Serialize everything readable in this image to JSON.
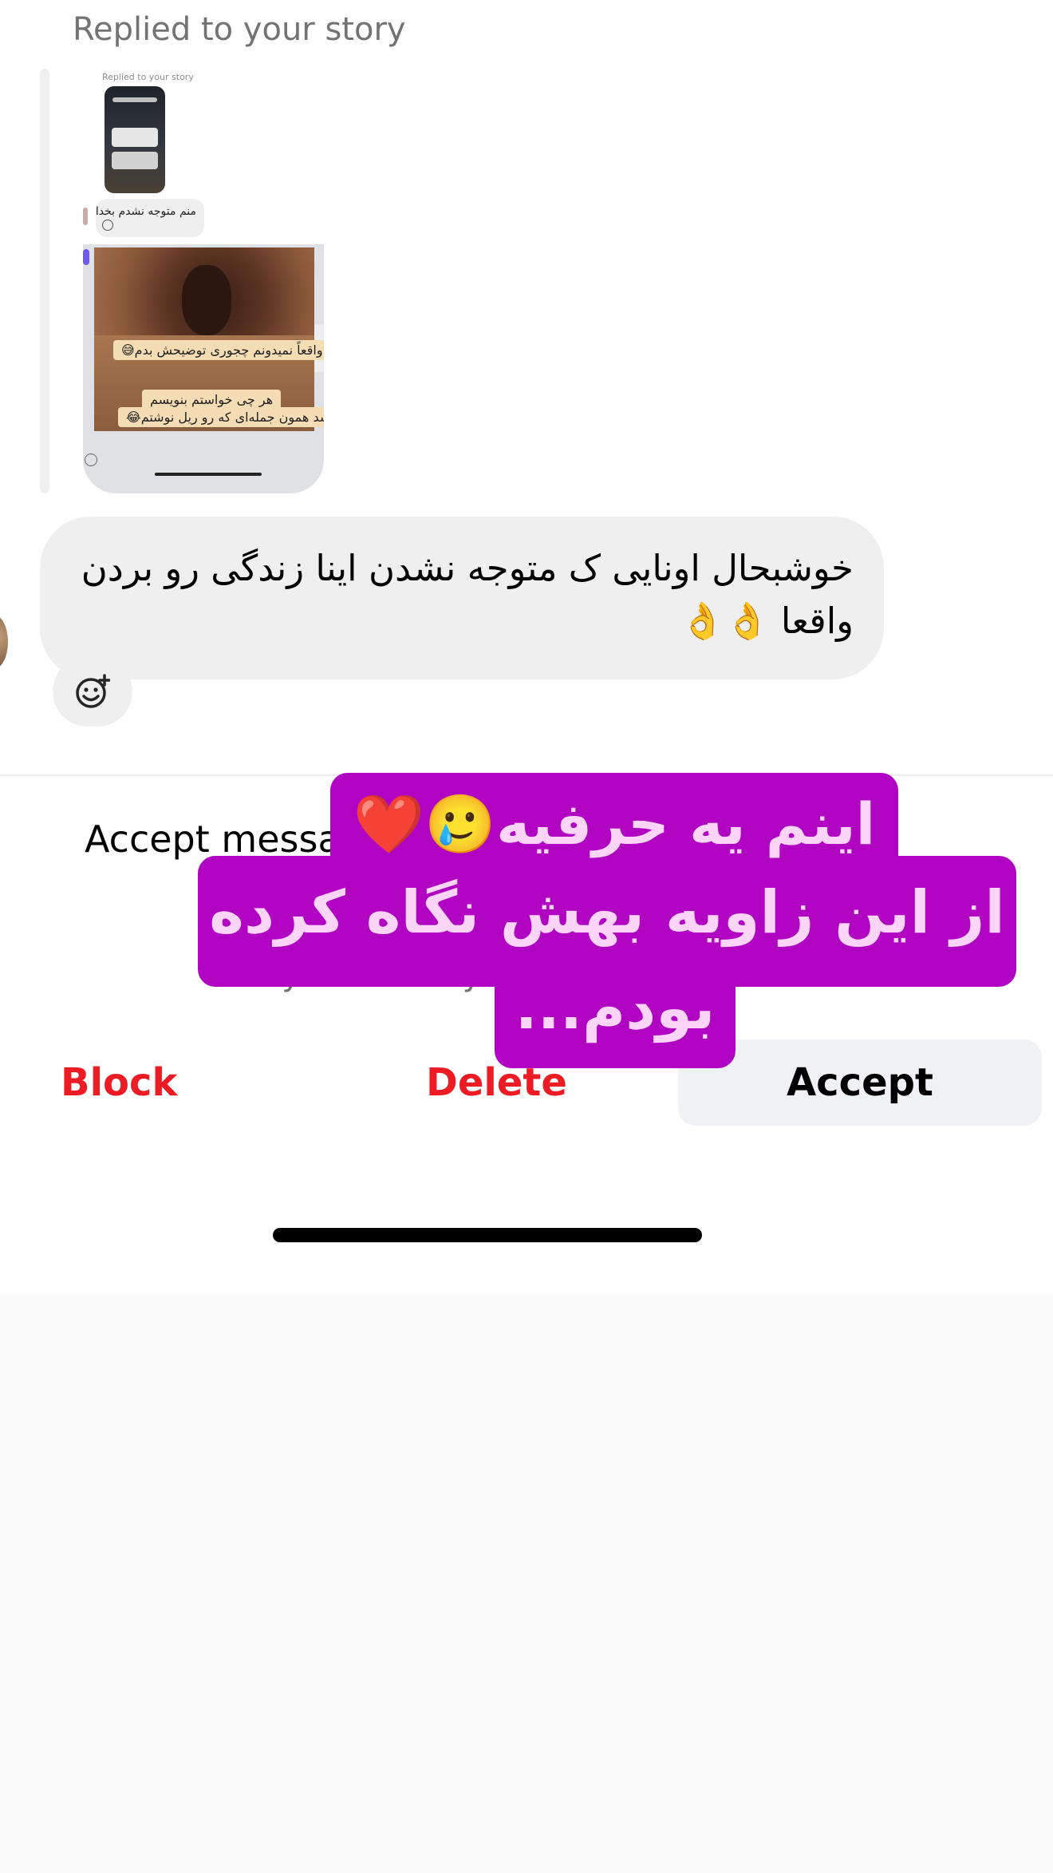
{
  "thread": {
    "reply_label": "Replied to your story",
    "story_preview": {
      "mini_label": "Replied to your story",
      "mini_message": "منم متوجه نشدم بخدا",
      "caption_line1": "دخترا واقعاً نمیدونم چجوری توضیحش بدم😅",
      "caption_line2": "هر چی خواستم بنویسم",
      "caption_line3": "دوباره شد همون جمله‌ای که رو ریل نوشتم😂"
    },
    "message_text": "خوشبحال اونایی ک متوجه نشدن اینا زندگی رو بردن واقعا 👌👌"
  },
  "request": {
    "title": "Accept messa",
    "description": "you accept, t                            \nyour activity status and"
  },
  "actions": {
    "block": "Block",
    "delete": "Delete",
    "accept": "Accept"
  },
  "sticker": {
    "line1": "اینم یه حرفیه🥲❤️",
    "line2": "از این زاویه بهش نگاه کرده",
    "line3": "بودم..."
  },
  "colors": {
    "destructive": "#ed1c24",
    "sticker_bg": "#b004c2",
    "sticker_text": "#fbd4f8",
    "bubble": "#efefef"
  },
  "icons": {
    "reaction": "add-reaction-icon"
  }
}
